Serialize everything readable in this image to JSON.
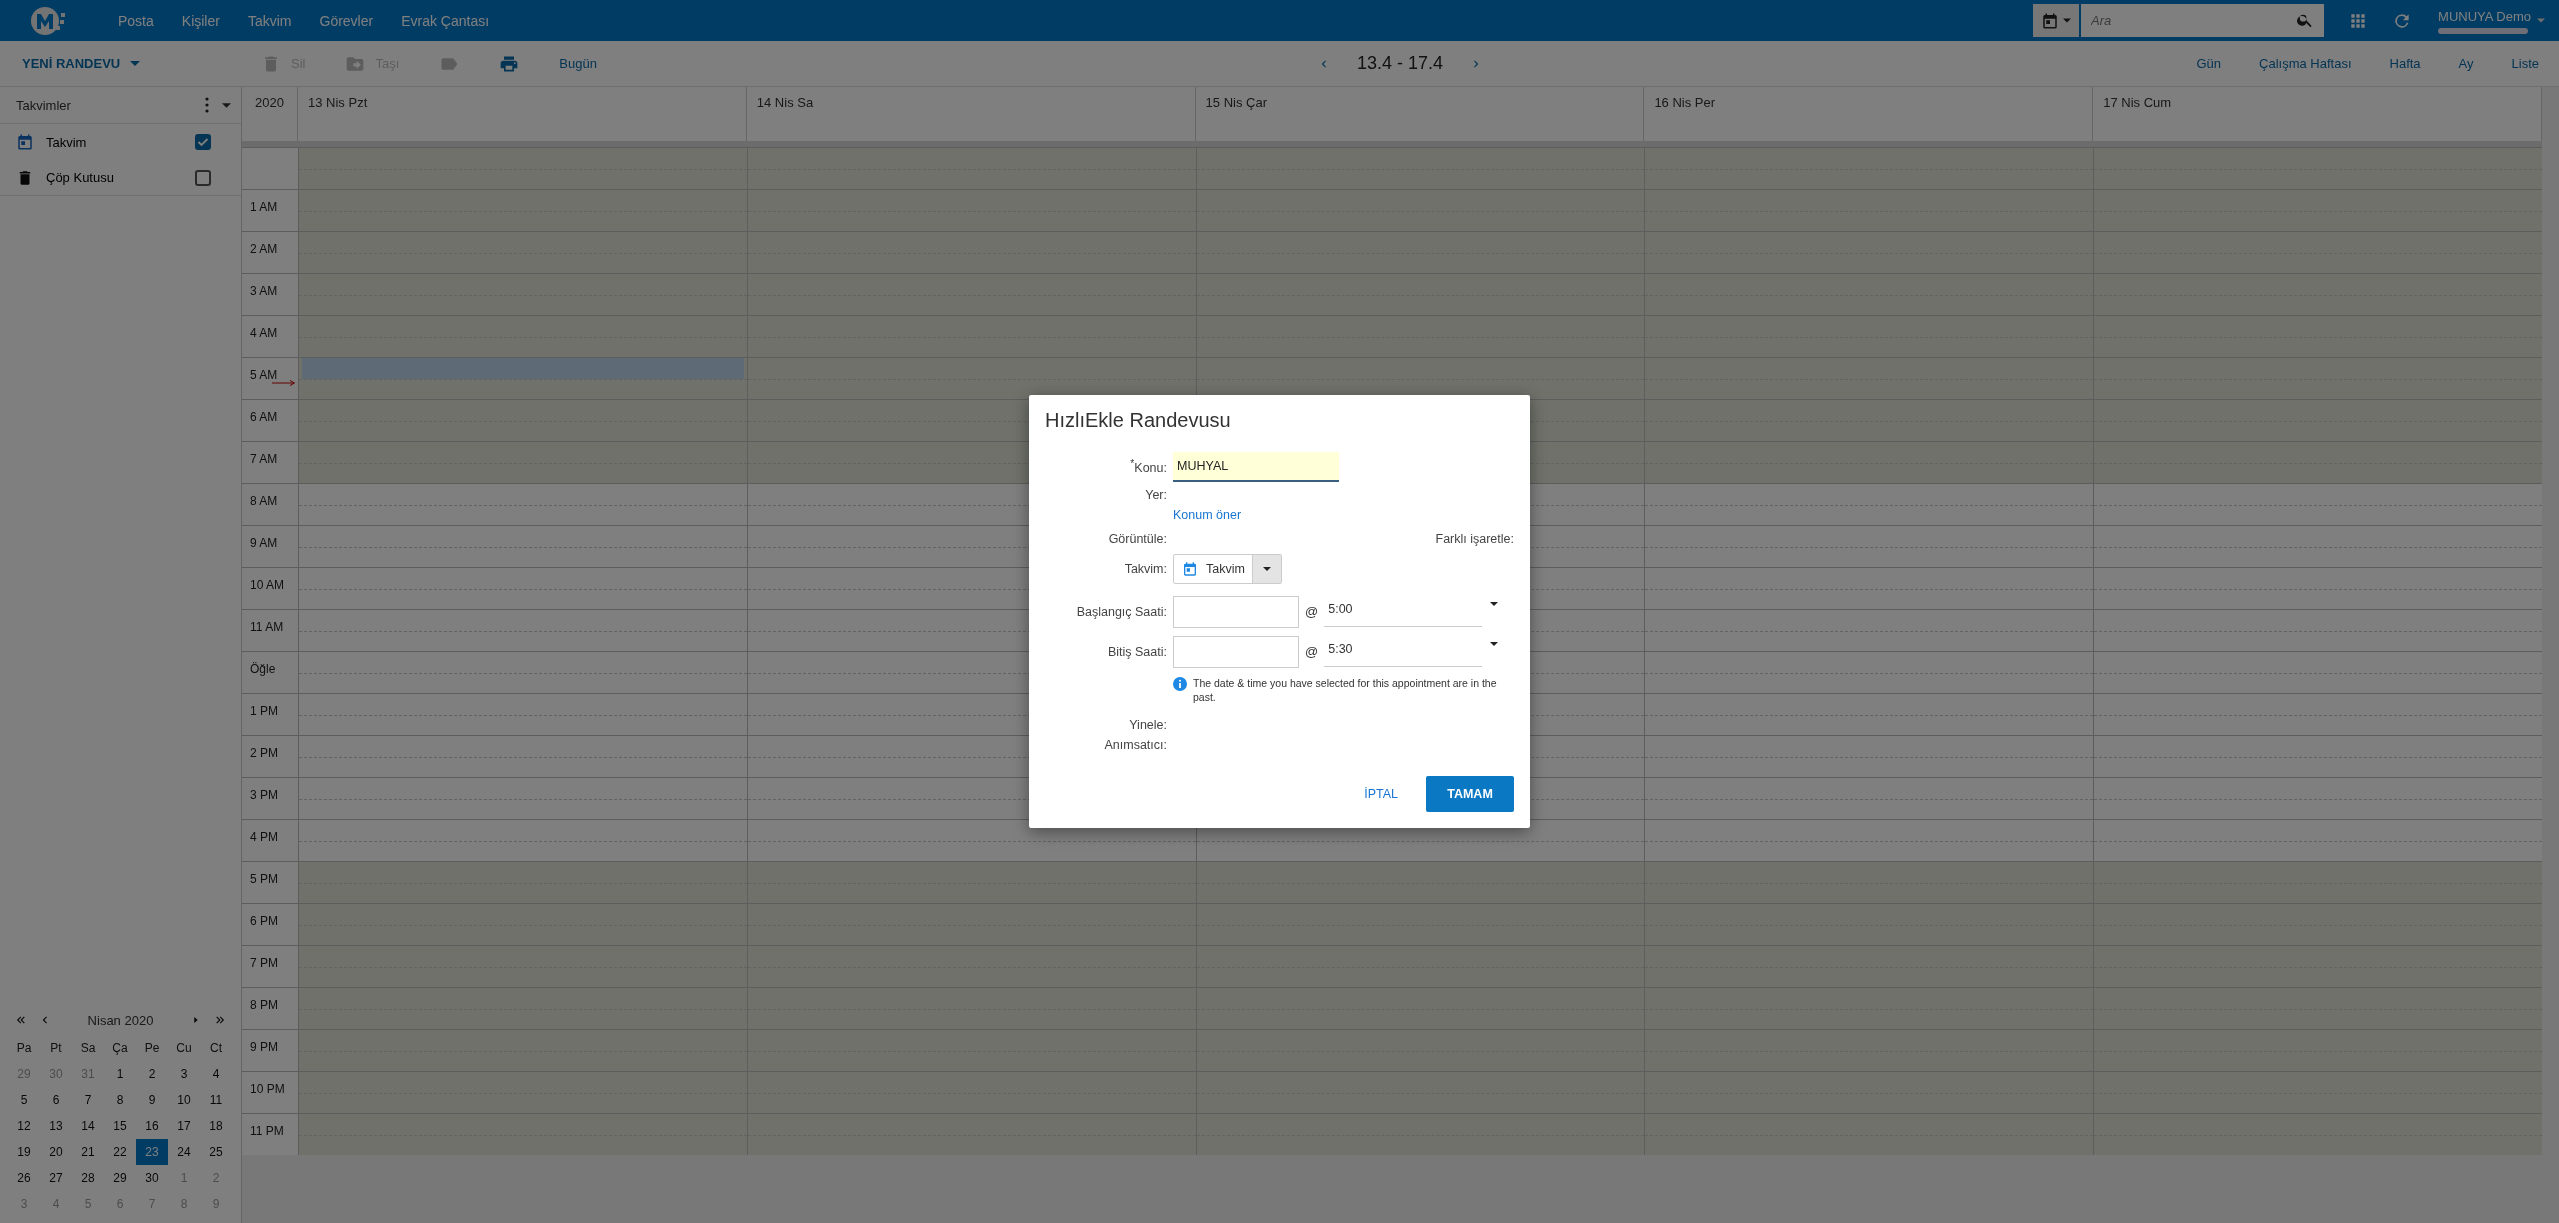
{
  "app_bar": {
    "nav": [
      "Posta",
      "Kişiler",
      "Takvim",
      "Görevler",
      "Evrak Çantası"
    ],
    "search": {
      "placeholder": "Ara"
    },
    "user": "MUNUYA Demo"
  },
  "toolbar": {
    "new_button": "YENİ RANDEVU",
    "actions": [
      {
        "kind": "delete",
        "label": "Sil",
        "disabled": true
      },
      {
        "kind": "move",
        "label": "Taşı",
        "disabled": true
      },
      {
        "kind": "tag",
        "disabled": true
      },
      {
        "kind": "print",
        "disabled": false
      },
      {
        "kind": "today",
        "label": "Bugün",
        "disabled": false
      }
    ],
    "range": "13.4 - 17.4",
    "views": [
      "Gün",
      "Çalışma Haftası",
      "Hafta",
      "Ay",
      "Liste"
    ]
  },
  "sidebar": {
    "title": "Takvimler",
    "calendars": [
      {
        "kind": "calendar",
        "name": "Takvim",
        "checked": true
      },
      {
        "kind": "trash",
        "name": "Çöp Kutusu",
        "checked": false
      }
    ]
  },
  "mini_calendar": {
    "title": "Nisan 2020",
    "weekdays": [
      "Pa",
      "Pt",
      "Sa",
      "Ça",
      "Pe",
      "Cu",
      "Ct"
    ],
    "weeks": [
      [
        {
          "day": "29",
          "other_month": true,
          "selected": false
        },
        {
          "day": "30",
          "other_month": true,
          "selected": false
        },
        {
          "day": "31",
          "other_month": true,
          "selected": false
        },
        {
          "day": "1",
          "other_month": false,
          "selected": false
        },
        {
          "day": "2",
          "other_month": false,
          "selected": false
        },
        {
          "day": "3",
          "other_month": false,
          "selected": false
        },
        {
          "day": "4",
          "other_month": false,
          "selected": false
        }
      ],
      [
        {
          "day": "5",
          "other_month": false,
          "selected": false
        },
        {
          "day": "6",
          "other_month": false,
          "selected": false
        },
        {
          "day": "7",
          "other_month": false,
          "selected": false
        },
        {
          "day": "8",
          "other_month": false,
          "selected": false
        },
        {
          "day": "9",
          "other_month": false,
          "selected": false
        },
        {
          "day": "10",
          "other_month": false,
          "selected": false
        },
        {
          "day": "11",
          "other_month": false,
          "selected": false
        }
      ],
      [
        {
          "day": "12",
          "other_month": false,
          "selected": false
        },
        {
          "day": "13",
          "other_month": false,
          "selected": false
        },
        {
          "day": "14",
          "other_month": false,
          "selected": false
        },
        {
          "day": "15",
          "other_month": false,
          "selected": false
        },
        {
          "day": "16",
          "other_month": false,
          "selected": false
        },
        {
          "day": "17",
          "other_month": false,
          "selected": false
        },
        {
          "day": "18",
          "other_month": false,
          "selected": false
        }
      ],
      [
        {
          "day": "19",
          "other_month": false,
          "selected": false
        },
        {
          "day": "20",
          "other_month": false,
          "selected": false
        },
        {
          "day": "21",
          "other_month": false,
          "selected": false
        },
        {
          "day": "22",
          "other_month": false,
          "selected": false
        },
        {
          "day": "23",
          "other_month": false,
          "selected": true
        },
        {
          "day": "24",
          "other_month": false,
          "selected": false
        },
        {
          "day": "25",
          "other_month": false,
          "selected": false
        }
      ],
      [
        {
          "day": "26",
          "other_month": false,
          "selected": false
        },
        {
          "day": "27",
          "other_month": false,
          "selected": false
        },
        {
          "day": "28",
          "other_month": false,
          "selected": false
        },
        {
          "day": "29",
          "other_month": false,
          "selected": false
        },
        {
          "day": "30",
          "other_month": false,
          "selected": false
        },
        {
          "day": "1",
          "other_month": true,
          "selected": false
        },
        {
          "day": "2",
          "other_month": true,
          "selected": false
        }
      ],
      [
        {
          "day": "3",
          "other_month": true,
          "selected": false
        },
        {
          "day": "4",
          "other_month": true,
          "selected": false
        },
        {
          "day": "5",
          "other_month": true,
          "selected": false
        },
        {
          "day": "6",
          "other_month": true,
          "selected": false
        },
        {
          "day": "7",
          "other_month": true,
          "selected": false
        },
        {
          "day": "8",
          "other_month": true,
          "selected": false
        },
        {
          "day": "9",
          "other_month": true,
          "selected": false
        }
      ]
    ]
  },
  "grid": {
    "year": "2020",
    "days": [
      {
        "label": "13 Nis Pzt"
      },
      {
        "label": "14 Nis Sa"
      },
      {
        "label": "15 Nis Çar"
      },
      {
        "label": "16 Nis Per"
      },
      {
        "label": "17 Nis Cum"
      }
    ],
    "hours": [
      {
        "working": false,
        "selected": false
      },
      {
        "label": "1 AM",
        "working": false,
        "selected": false
      },
      {
        "label": "2 AM",
        "working": false,
        "selected": false
      },
      {
        "label": "3 AM",
        "working": false,
        "selected": false
      },
      {
        "label": "4 AM",
        "working": false,
        "selected": false
      },
      {
        "label": "5 AM",
        "working": false,
        "selected": true
      },
      {
        "label": "6 AM",
        "working": false,
        "selected": false
      },
      {
        "label": "7 AM",
        "working": false,
        "selected": false
      },
      {
        "label": "8 AM",
        "working": true,
        "selected": false
      },
      {
        "label": "9 AM",
        "working": true,
        "selected": false
      },
      {
        "label": "10 AM",
        "working": true,
        "selected": false
      },
      {
        "label": "11 AM",
        "working": true,
        "selected": false
      },
      {
        "label": "Öğle",
        "working": true,
        "selected": false
      },
      {
        "label": "1 PM",
        "working": true,
        "selected": false
      },
      {
        "label": "2 PM",
        "working": true,
        "selected": false
      },
      {
        "label": "3 PM",
        "working": true,
        "selected": false
      },
      {
        "label": "4 PM",
        "working": true,
        "selected": false
      },
      {
        "label": "5 PM",
        "working": false,
        "selected": false
      },
      {
        "label": "6 PM",
        "working": false,
        "selected": false
      },
      {
        "label": "7 PM",
        "working": false,
        "selected": false
      },
      {
        "label": "8 PM",
        "working": false,
        "selected": false
      },
      {
        "label": "9 PM",
        "working": false,
        "selected": false
      },
      {
        "label": "10 PM",
        "working": false,
        "selected": false
      },
      {
        "label": "11 PM",
        "working": false,
        "selected": false
      }
    ]
  },
  "dialog": {
    "title": "HızlıEkle Randevusu",
    "subject": {
      "label": "$^{*}$Konu:",
      "value": "MUHYAL"
    },
    "location": {
      "label": "Yer:",
      "link": "Konum öner"
    },
    "show_as": "Görüntüle:",
    "mark_as": "Farklı işaretle:",
    "calendar": {
      "label": "Takvim:",
      "value": "Takvim"
    },
    "times": [
      {
        "label": "Başlangıç Saati:",
        "at": "@",
        "time": "5:00"
      },
      {
        "label": "Bitiş Saati:",
        "at": "@",
        "time": "5:30"
      }
    ],
    "notice": "The date & time you have selected for this appointment are in the past.",
    "repeat": "Yinele:",
    "reminder": "Anımsatıcı:",
    "buttons": [
      {
        "kind": "text",
        "label": "İPTAL"
      },
      {
        "kind": "primary",
        "label": "TAMAM"
      }
    ]
  }
}
